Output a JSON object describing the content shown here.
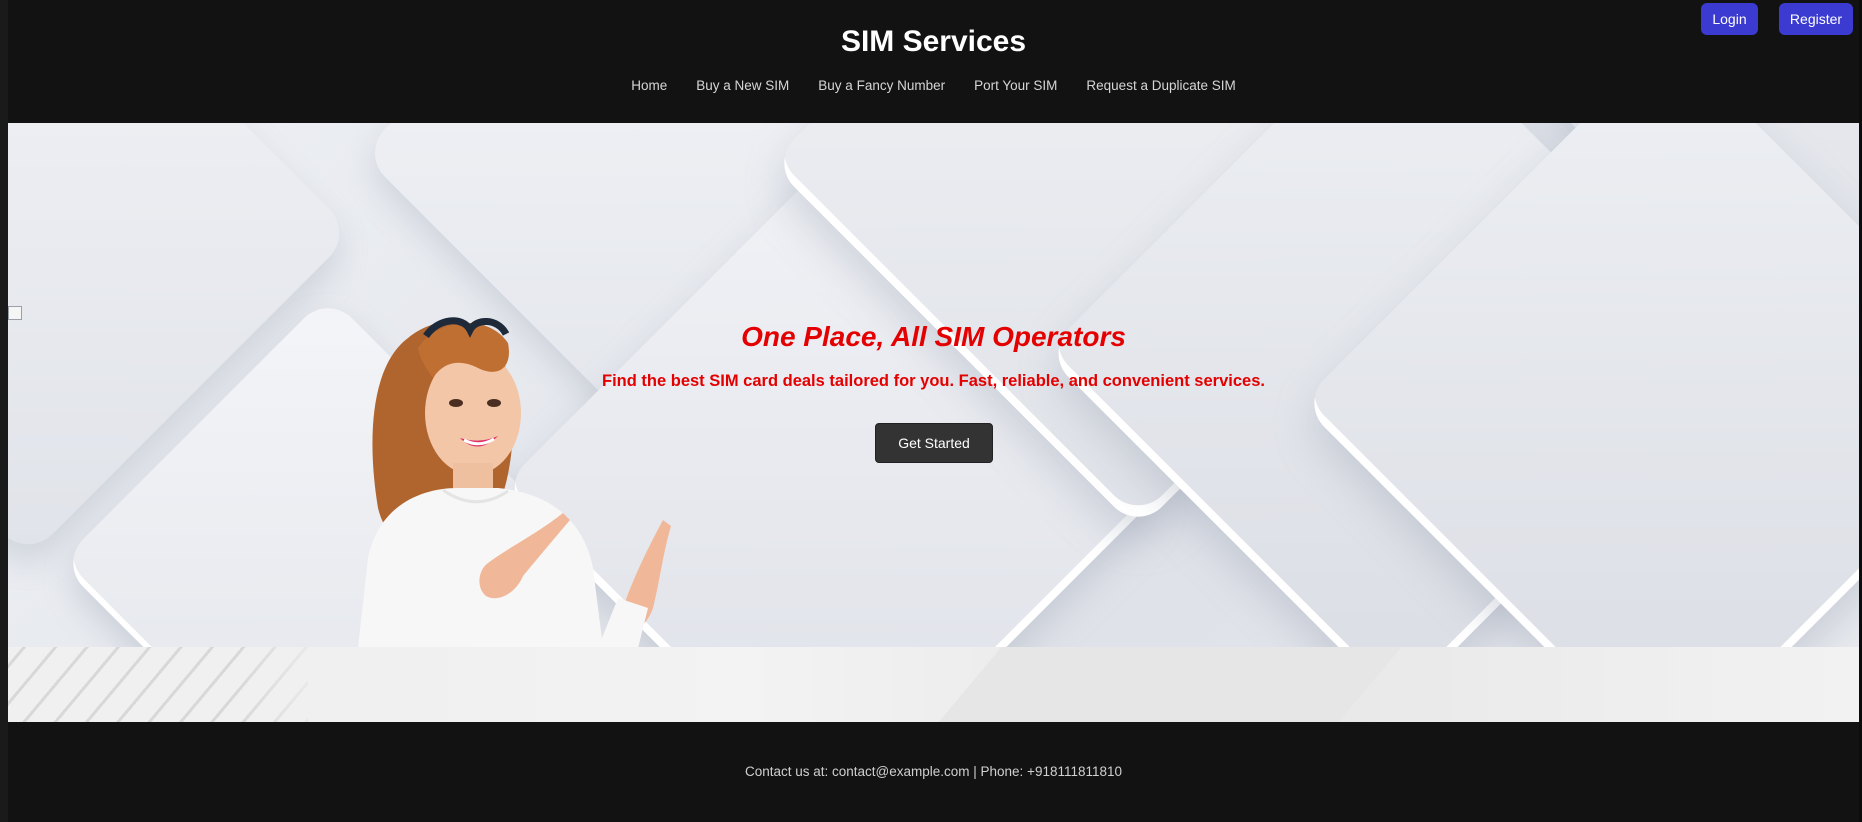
{
  "header": {
    "title": "SIM Services",
    "nav": [
      {
        "label": "Home"
      },
      {
        "label": "Buy a New SIM"
      },
      {
        "label": "Buy a Fancy Number"
      },
      {
        "label": "Port Your SIM"
      },
      {
        "label": "Request a Duplicate SIM"
      }
    ],
    "login_label": "Login",
    "register_label": "Register"
  },
  "hero": {
    "headline": "One Place, All SIM Operators",
    "subheadline": "Find the best SIM card deals tailored for you. Fast, reliable, and convenient services.",
    "cta_label": "Get Started"
  },
  "footer": {
    "contact": "Contact us at: contact@example.com | Phone: +918111811810"
  },
  "colors": {
    "background": "#121212",
    "accent_button": "#3b3bd1",
    "headline_red": "#e40000",
    "cta_dark": "#333333"
  }
}
